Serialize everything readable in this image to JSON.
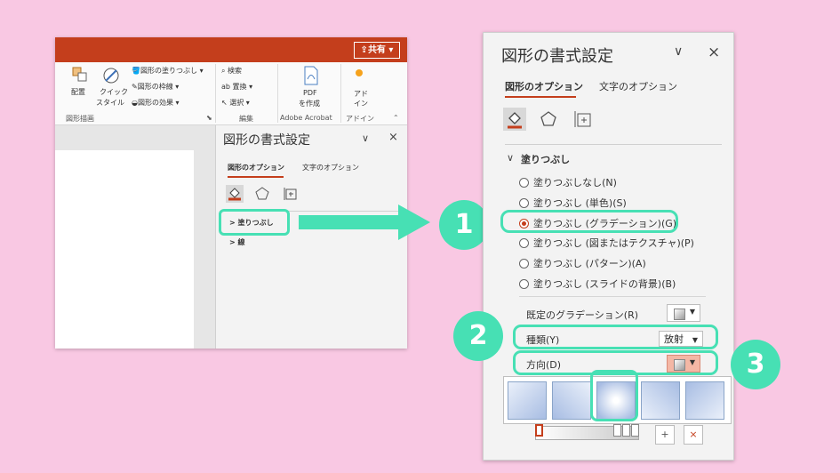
{
  "left": {
    "share_label": "共有",
    "ribbon": {
      "arrange": "配置",
      "quick_style_1": "クイック",
      "quick_style_2": "スタイル",
      "fill": "図形の塗りつぶし",
      "outline": "図形の枠線",
      "effects": "図形の効果",
      "group_drawing": "図形描画",
      "find": "検索",
      "replace": "置換",
      "select": "選択",
      "group_edit": "編集",
      "pdf_1": "PDF",
      "pdf_2": "を作成",
      "group_acrobat": "Adobe Acrobat",
      "addin_1": "アド",
      "addin_2": "イン",
      "group_addin": "アドイン"
    },
    "pane": {
      "title": "図形の書式設定",
      "tab_shape": "図形のオプション",
      "tab_text": "文字のオプション",
      "item_fill": "> 塗りつぶし",
      "item_line": "> 線"
    }
  },
  "right": {
    "title": "図形の書式設定",
    "dropdown_icon": "∨",
    "close_icon": "×",
    "tab_shape": "図形のオプション",
    "tab_text": "文字のオプション",
    "section_fill": "塗りつぶし",
    "radio_options": [
      "塗りつぶしなし(N)",
      "塗りつぶし (単色)(S)",
      "塗りつぶし (グラデーション)(G)",
      "塗りつぶし (図またはテクスチャ)(P)",
      "塗りつぶし (パターン)(A)",
      "塗りつぶし (スライドの背景)(B)"
    ],
    "preset_label": "既定のグラデーション(R)",
    "type_label": "種類(Y)",
    "type_value": "放射",
    "direction_label": "方向(D)"
  },
  "callouts": {
    "n1": "1",
    "n2": "2",
    "n3": "3"
  },
  "colors": {
    "accent": "#47e0b4",
    "brand": "#c43e1c",
    "background": "#f9c8e3"
  }
}
